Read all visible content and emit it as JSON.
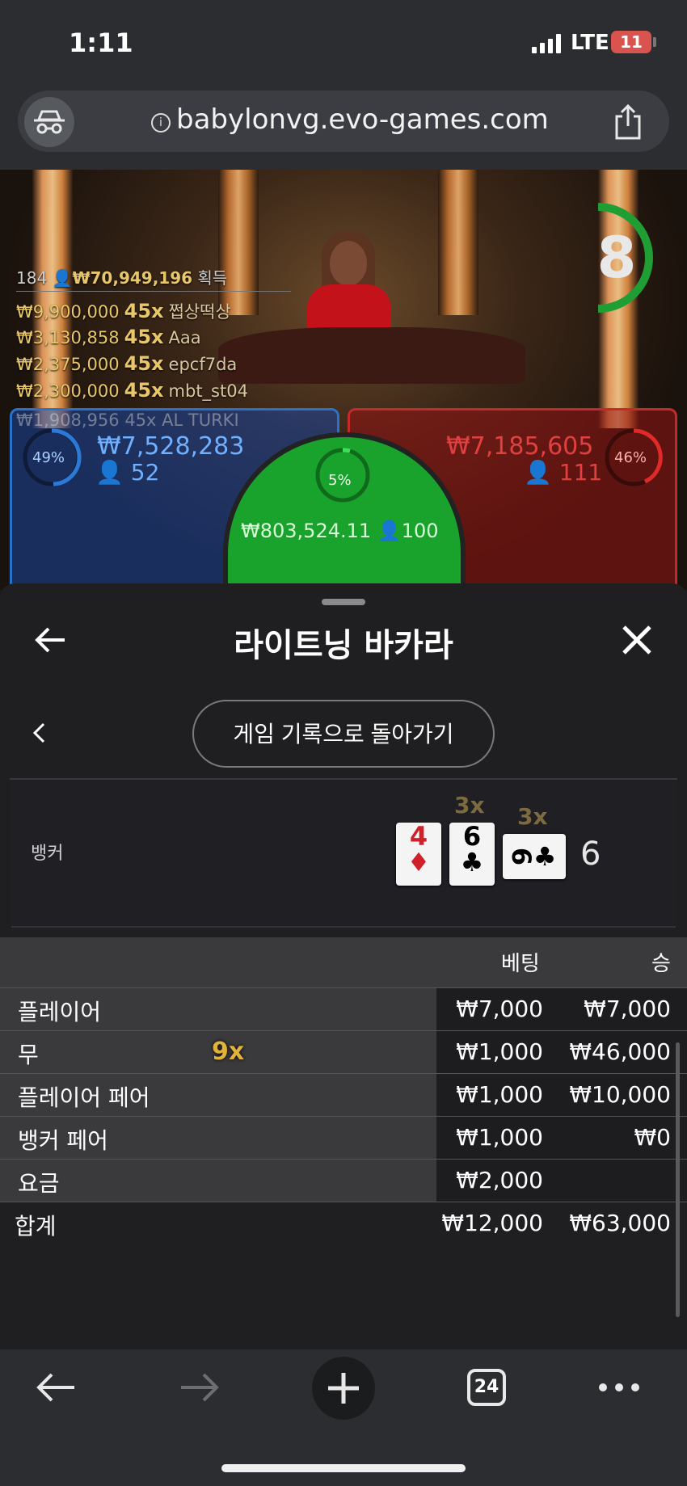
{
  "status_bar": {
    "time": "1:11",
    "network": "LTE",
    "battery": "11"
  },
  "browser": {
    "url": "babylonvg.evo-games.com",
    "tab_count": "24"
  },
  "game": {
    "countdown": "8",
    "total_players": "184",
    "total_won": "₩70,949,196",
    "total_won_label": "획득",
    "winners": [
      {
        "amount": "₩9,900,000",
        "multiplier": "45x",
        "name": "쩝상떡상"
      },
      {
        "amount": "₩3,130,858",
        "multiplier": "45x",
        "name": "Aaa"
      },
      {
        "amount": "₩2,375,000",
        "multiplier": "45x",
        "name": "epcf7da"
      },
      {
        "amount": "₩2,300,000",
        "multiplier": "45x",
        "name": "mbt_st04"
      }
    ],
    "faded_winner": "₩1,908,956 45x AL TURKI",
    "player_zone": {
      "percent": "49%",
      "amount": "₩7,528,283",
      "players": "52",
      "percent_value": 49
    },
    "banker_zone": {
      "percent": "46%",
      "amount": "₩7,185,605",
      "players": "111",
      "percent_value": 46
    },
    "tie_zone": {
      "percent": "5%",
      "amount": "₩803,524.11",
      "players": "100",
      "percent_value": 5
    }
  },
  "panel": {
    "title": "라이트닝 바카라",
    "back_to_history": "게임 기록으로 돌아가기",
    "hand": {
      "label": "뱅커",
      "cards": [
        {
          "rank": "4",
          "suit": "♦",
          "color": "#d0202a"
        },
        {
          "rank": "6",
          "suit": "♣",
          "color": "#111111",
          "multiplier": "3x"
        },
        {
          "rank": "6",
          "suit": "♣",
          "color": "#111111",
          "multiplier": "3x",
          "rotated": true
        }
      ],
      "score": "6"
    },
    "table": {
      "headers": {
        "bet": "베팅",
        "win": "승"
      },
      "rows": [
        {
          "label": "플레이어",
          "bet": "₩7,000",
          "win": "₩7,000"
        },
        {
          "label": "무",
          "bet": "₩1,000",
          "win": "₩46,000",
          "multiplier": "9x"
        },
        {
          "label": "플레이어 페어",
          "bet": "₩1,000",
          "win": "₩10,000"
        },
        {
          "label": "뱅커 페어",
          "bet": "₩1,000",
          "win": "₩0"
        },
        {
          "label": "요금",
          "bet": "₩2,000",
          "win": ""
        }
      ],
      "total": {
        "label": "합계",
        "bet": "₩12,000",
        "win": "₩63,000"
      }
    }
  }
}
